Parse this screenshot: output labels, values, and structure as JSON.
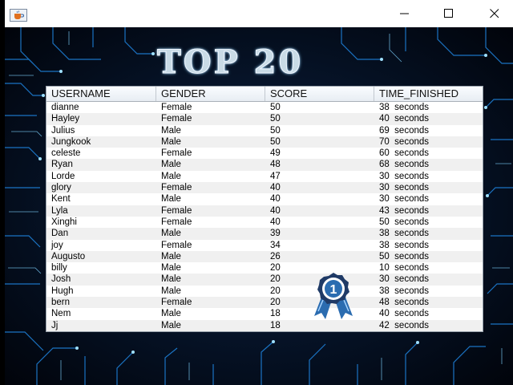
{
  "window": {
    "icon": "java-coffee-icon",
    "buttons": [
      "minimize-icon",
      "maximize-icon",
      "close-icon"
    ]
  },
  "banner": {
    "title": "TOP 20"
  },
  "table": {
    "columns": [
      "USERNAME",
      "GENDER",
      "SCORE",
      "TIME_FINISHED"
    ],
    "rows": [
      [
        "dianne",
        "Female",
        "50",
        "38  seconds"
      ],
      [
        "Hayley",
        "Female",
        "50",
        "40  seconds"
      ],
      [
        "Julius",
        "Male",
        "50",
        "69  seconds"
      ],
      [
        "Jungkook",
        "Male",
        "50",
        "70  seconds"
      ],
      [
        "celeste",
        "Female",
        "49",
        "60  seconds"
      ],
      [
        "Ryan",
        "Male",
        "48",
        "68  seconds"
      ],
      [
        "Lorde",
        "Male",
        "47",
        "30  seconds"
      ],
      [
        "glory",
        "Female",
        "40",
        "30  seconds"
      ],
      [
        "Kent",
        "Male",
        "40",
        "30  seconds"
      ],
      [
        "Lyla",
        "Female",
        "40",
        "43  seconds"
      ],
      [
        "Xinghi",
        "Female",
        "40",
        "50  seconds"
      ],
      [
        "Dan",
        "Male",
        "39",
        "38  seconds"
      ],
      [
        "joy",
        "Female",
        "34",
        "38  seconds"
      ],
      [
        "Augusto",
        "Male",
        "26",
        "50  seconds"
      ],
      [
        "billy",
        "Male",
        "20",
        "10  seconds"
      ],
      [
        "Josh",
        "Male",
        "20",
        "30  seconds"
      ],
      [
        "Hugh",
        "Male",
        "20",
        "38  seconds"
      ],
      [
        "bern",
        "Female",
        "20",
        "48  seconds"
      ],
      [
        "Nem",
        "Male",
        "18",
        "40  seconds"
      ],
      [
        "Jj",
        "Male",
        "18",
        "42  seconds"
      ]
    ]
  },
  "badge": {
    "icon": "first-place-ribbon-icon",
    "number": "1"
  },
  "colors": {
    "background": "#02060f",
    "circuit": "#1e7fd6",
    "glow": "#7fd3ff",
    "medal": "#2b6cb0"
  }
}
